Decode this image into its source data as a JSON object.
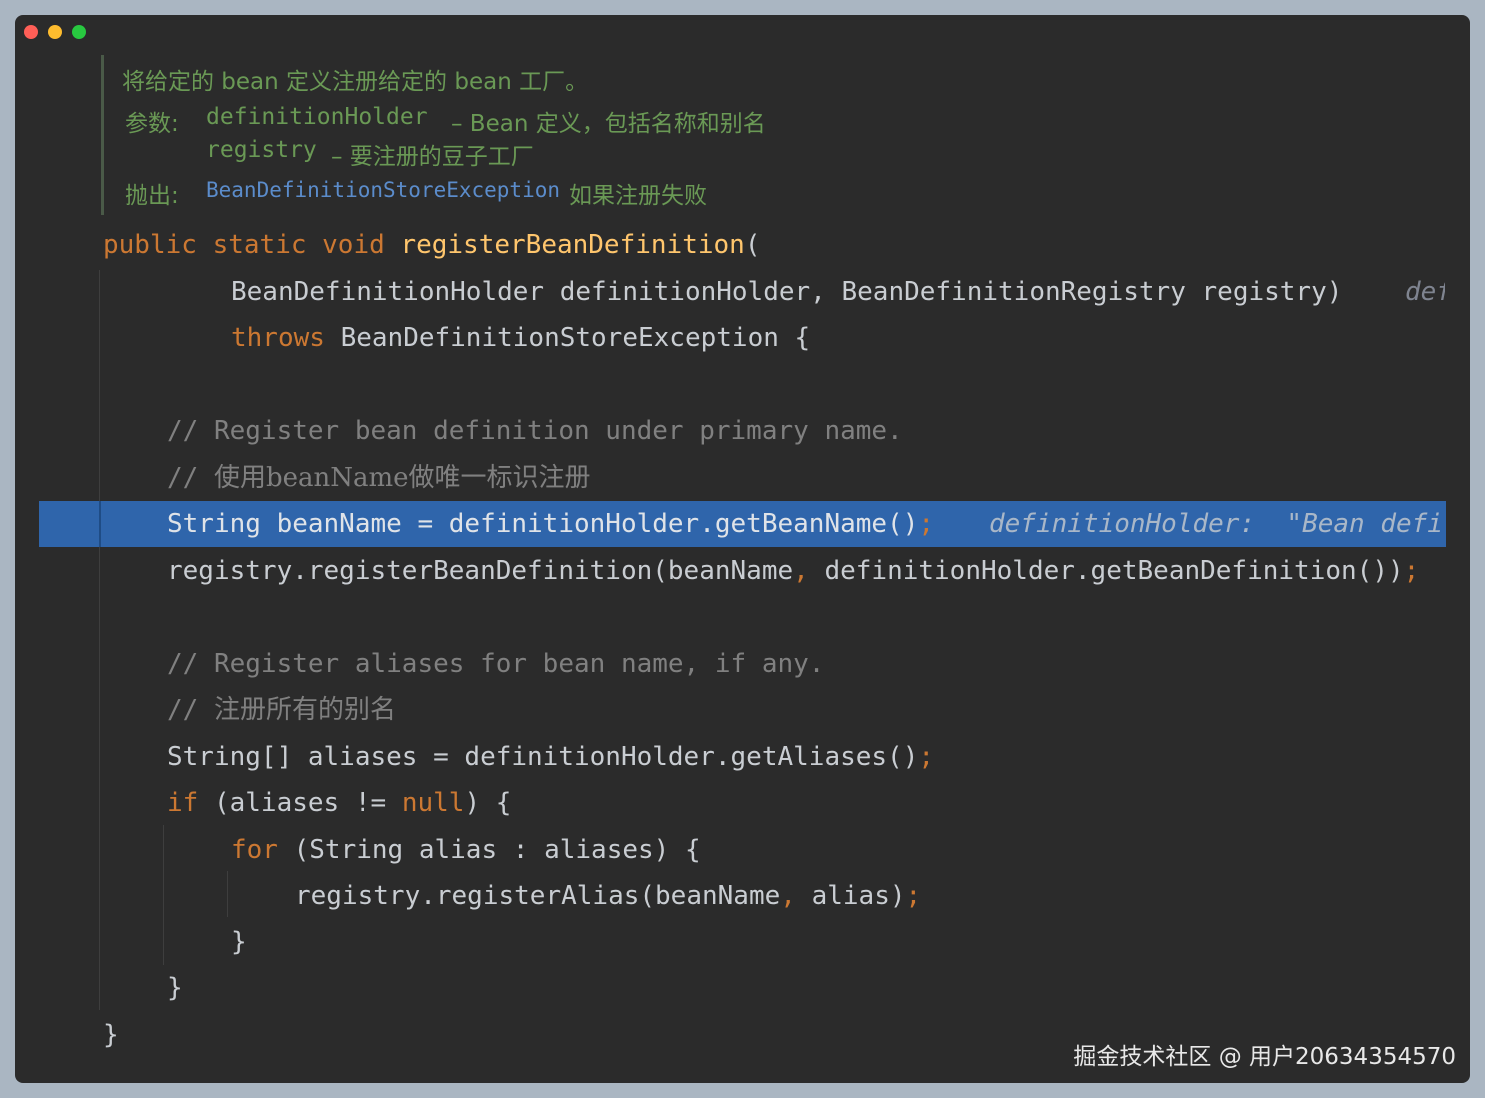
{
  "window": {
    "controls": [
      "close",
      "minimize",
      "maximize"
    ]
  },
  "doc": {
    "summary": "将给定的 bean 定义注册给定的 bean 工厂。",
    "params_label": "参数:",
    "param1_name": "definitionHolder",
    "param1_desc": "– Bean 定义，包括名称和别名",
    "param2_name": "registry",
    "param2_desc": "– 要注册的豆子工厂",
    "throws_label": "抛出:",
    "throws_type": "BeanDefinitionStoreException",
    "throws_desc": "如果注册失败"
  },
  "code": {
    "l1_kw1": "public",
    "l1_kw2": "static",
    "l1_kw3": "void",
    "l1_fn": "registerBeanDefinition",
    "l1_paren": "(",
    "l2_text": "BeanDefinitionHolder definitionHolder, BeanDefinitionRegistry registry)",
    "l2_hint": "def",
    "l3_kw": "throws",
    "l3_text": "BeanDefinitionStoreException {",
    "c1": "// Register bean definition under primary name.",
    "c2_slash": "//",
    "c2_text": "使用beanName做唯一标识注册",
    "l4_text": "String beanName = definitionHolder.getBeanName()",
    "l4_semi": ";",
    "l4_hint": "definitionHolder:  \"Bean defi",
    "l5_text": "registry.registerBeanDefinition(beanName",
    "l5_comma": ",",
    "l5_text2": " definitionHolder.getBeanDefinition())",
    "l5_semi": ";",
    "c3": "// Register aliases for bean name, if any.",
    "c4_slash": "//",
    "c4_text": "注册所有的别名",
    "l6_text": "String[] aliases = definitionHolder.getAliases()",
    "l6_semi": ";",
    "l7_kw": "if",
    "l7_text": " (aliases != ",
    "l7_null": "null",
    "l7_text2": ") {",
    "l8_kw": "for",
    "l8_text": " (String alias : aliases) {",
    "l9_text": "registry.registerAlias(beanName",
    "l9_comma": ",",
    "l9_text2": " alias)",
    "l9_semi": ";",
    "l10": "}",
    "l11": "}",
    "l12": "}"
  },
  "watermark": "掘金技术社区 @ 用户20634354570",
  "colors": {
    "background": "#2b2b2b",
    "keyword": "#cc7832",
    "function": "#ffc66d",
    "comment": "#808080",
    "doc": "#6a9955",
    "selection": "#2f65ab"
  }
}
